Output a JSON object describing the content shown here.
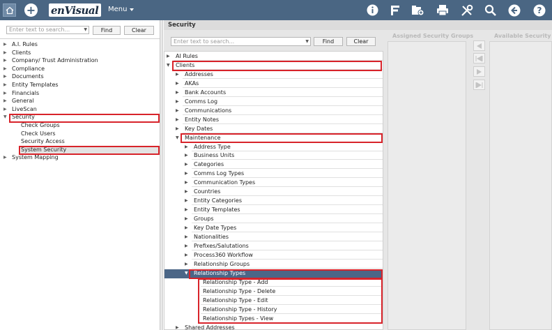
{
  "topbar": {
    "logo_en": "en",
    "logo_visual": "Visual",
    "menu_label": "Menu",
    "icons": [
      "home-icon",
      "add-icon",
      "info-icon",
      "fast-forms-icon",
      "add-document-icon",
      "print-icon",
      "tools-icon",
      "search-icon",
      "back-icon",
      "help-icon"
    ]
  },
  "left_panel": {
    "search_placeholder": "Enter text to search...",
    "find_label": "Find",
    "clear_label": "Clear",
    "items": [
      {
        "label": "A.I. Rules",
        "expanded": false
      },
      {
        "label": "Clients",
        "expanded": false
      },
      {
        "label": "Company/ Trust Administration",
        "expanded": false
      },
      {
        "label": "Compliance",
        "expanded": false
      },
      {
        "label": "Documents",
        "expanded": false
      },
      {
        "label": "Entity Templates",
        "expanded": false
      },
      {
        "label": "Financials",
        "expanded": false
      },
      {
        "label": "General",
        "expanded": false
      },
      {
        "label": "LiveScan",
        "expanded": false
      },
      {
        "label": "Security",
        "expanded": true
      },
      {
        "label": "Check Groups",
        "child": true
      },
      {
        "label": "Check Users",
        "child": true
      },
      {
        "label": "Security Access",
        "child": true
      },
      {
        "label": "System Security",
        "child": true,
        "selected": true
      },
      {
        "label": "System Mapping",
        "expanded": false
      }
    ]
  },
  "security": {
    "header": "Security",
    "search_placeholder": "Enter text to search...",
    "find_label": "Find",
    "clear_label": "Clear",
    "assigned_title": "Assigned Security Groups",
    "available_title": "Available Security",
    "tree": [
      {
        "label": "AI Rules",
        "level": 0
      },
      {
        "label": "Clients",
        "level": 0,
        "open": true
      },
      {
        "label": "Addresses",
        "level": 1
      },
      {
        "label": "AKAs",
        "level": 1
      },
      {
        "label": "Bank Accounts",
        "level": 1
      },
      {
        "label": "Comms Log",
        "level": 1
      },
      {
        "label": "Communications",
        "level": 1
      },
      {
        "label": "Entity Notes",
        "level": 1
      },
      {
        "label": "Key Dates",
        "level": 1
      },
      {
        "label": "Maintenance",
        "level": 1,
        "open": true
      },
      {
        "label": "Address Type",
        "level": 2
      },
      {
        "label": "Business Units",
        "level": 2
      },
      {
        "label": "Categories",
        "level": 2
      },
      {
        "label": "Comms Log Types",
        "level": 2
      },
      {
        "label": "Communication Types",
        "level": 2
      },
      {
        "label": "Countries",
        "level": 2
      },
      {
        "label": "Entity Categories",
        "level": 2
      },
      {
        "label": "Entity Templates",
        "level": 2
      },
      {
        "label": "Groups",
        "level": 2
      },
      {
        "label": "Key Date Types",
        "level": 2
      },
      {
        "label": "Nationalities",
        "level": 2
      },
      {
        "label": "Prefixes/Salutations",
        "level": 2
      },
      {
        "label": "Process360 Workflow",
        "level": 2
      },
      {
        "label": "Relationship Groups",
        "level": 2
      },
      {
        "label": "Relationship Types",
        "level": 2,
        "open": true,
        "selected": true
      },
      {
        "label": "Relationship Type - Add",
        "level": 3
      },
      {
        "label": "Relationship Type - Delete",
        "level": 3
      },
      {
        "label": "Relationship Type - Edit",
        "level": 3
      },
      {
        "label": "Relationship Type - History",
        "level": 3
      },
      {
        "label": "Relationship Types - View",
        "level": 3
      },
      {
        "label": "Shared Addresses",
        "level": 1
      }
    ]
  }
}
